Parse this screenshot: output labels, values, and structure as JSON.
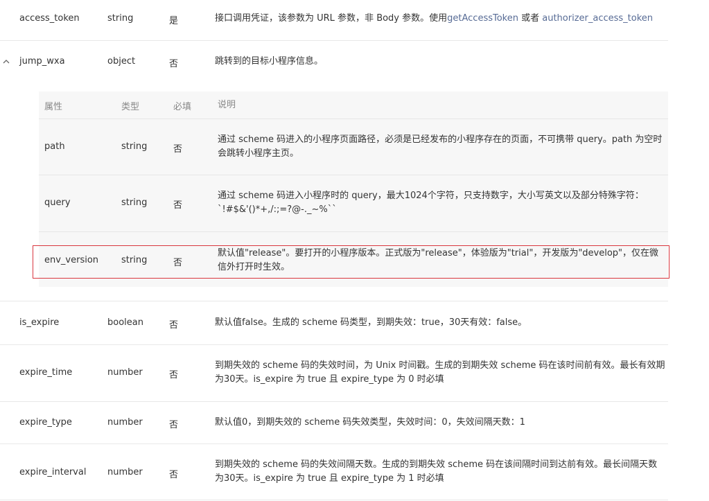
{
  "rows": [
    {
      "name": "access_token",
      "type": "string",
      "required": "是",
      "desc_pre": "接口调用凭证，该参数为 URL 参数，非 Body 参数。使用",
      "link1": "getAccessToken",
      "desc_mid": " 或者 ",
      "link2": "authorizer_access_token"
    },
    {
      "name": "jump_wxa",
      "type": "object",
      "required": "否",
      "desc": "跳转到的目标小程序信息。"
    },
    {
      "name": "is_expire",
      "type": "boolean",
      "required": "否",
      "desc": "默认值false。生成的 scheme 码类型，到期失效：true，30天有效：false。"
    },
    {
      "name": "expire_time",
      "type": "number",
      "required": "否",
      "desc": "到期失效的 scheme 码的失效时间，为 Unix 时间戳。生成的到期失效 scheme 码在该时间前有效。最长有效期为30天。is_expire 为 true 且 expire_type 为 0 时必填"
    },
    {
      "name": "expire_type",
      "type": "number",
      "required": "否",
      "desc": "默认值0，到期失效的 scheme 码失效类型，失效时间：0，失效间隔天数：1"
    },
    {
      "name": "expire_interval",
      "type": "number",
      "required": "否",
      "desc": "到期失效的 scheme 码的失效间隔天数。生成的到期失效 scheme 码在该间隔时间到达前有效。最长间隔天数为30天。is_expire 为 true 且 expire_type 为 1 时必填"
    }
  ],
  "expand_icon": "chevron-up",
  "sub_header": {
    "attr": "属性",
    "type": "类型",
    "required": "必填",
    "desc": "说明"
  },
  "sub_rows": [
    {
      "name": "path",
      "type": "string",
      "required": "否",
      "desc": "通过 scheme 码进入的小程序页面路径，必须是已经发布的小程序存在的页面，不可携带 query。path 为空时会跳转小程序主页。"
    },
    {
      "name": "query",
      "type": "string",
      "required": "否",
      "desc": "通过 scheme 码进入小程序时的 query，最大1024个字符，只支持数字，大小写英文以及部分特殊字符：`!#$&'()*+,/:;=?@-._~%``"
    },
    {
      "name": "env_version",
      "type": "string",
      "required": "否",
      "desc": "默认值\"release\"。要打开的小程序版本。正式版为\"release\"，体验版为\"trial\"，开发版为\"develop\"，仅在微信外打开时生效。"
    }
  ],
  "highlight_color": "#d9363e",
  "link_color": "#576b95"
}
